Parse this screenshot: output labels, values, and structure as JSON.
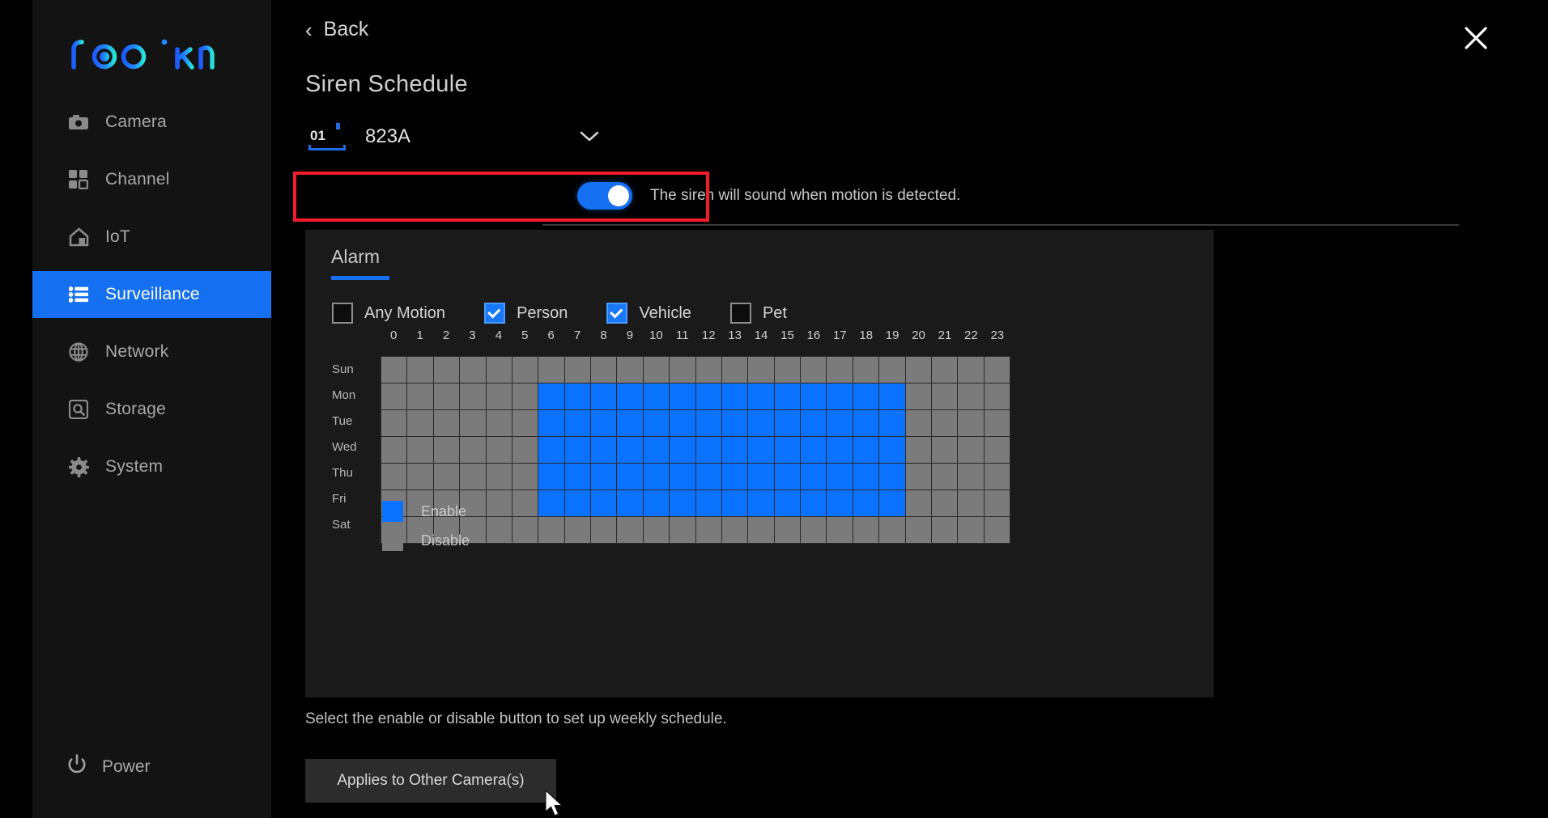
{
  "brand": {
    "name": "reolink"
  },
  "sidebar": {
    "items": [
      {
        "label": "Camera",
        "icon": "camera-icon",
        "active": false
      },
      {
        "label": "Channel",
        "icon": "channel-grid-icon",
        "active": false
      },
      {
        "label": "IoT",
        "icon": "home-iot-icon",
        "active": false
      },
      {
        "label": "Surveillance",
        "icon": "list-icon",
        "active": true
      },
      {
        "label": "Network",
        "icon": "globe-icon",
        "active": false
      },
      {
        "label": "Storage",
        "icon": "hdd-search-icon",
        "active": false
      },
      {
        "label": "System",
        "icon": "gear-icon",
        "active": false
      }
    ],
    "power": {
      "label": "Power",
      "icon": "power-icon"
    }
  },
  "header": {
    "back_label": "Back",
    "back_icon": "chevron-left-icon",
    "close_icon": "close-icon",
    "title": "Siren Schedule"
  },
  "channel_selector": {
    "number": "01",
    "name": "823A",
    "chevron_icon": "chevron-down-icon"
  },
  "siren_toggle": {
    "state": "on",
    "description": "The siren will sound when motion is detected.",
    "highlight_color": "#f41c28"
  },
  "panel": {
    "tab_label": "Alarm",
    "tab_accent": "#1470f0",
    "detection_types": [
      {
        "label": "Any Motion",
        "checked": false
      },
      {
        "label": "Person",
        "checked": true
      },
      {
        "label": "Vehicle",
        "checked": true
      },
      {
        "label": "Pet",
        "checked": false
      }
    ],
    "hours": [
      "0",
      "1",
      "2",
      "3",
      "4",
      "5",
      "6",
      "7",
      "8",
      "9",
      "10",
      "11",
      "12",
      "13",
      "14",
      "15",
      "16",
      "17",
      "18",
      "19",
      "20",
      "21",
      "22",
      "23"
    ],
    "days": [
      "Sun",
      "Mon",
      "Tue",
      "Wed",
      "Thu",
      "Fri",
      "Sat"
    ],
    "schedule": [
      [
        0,
        0,
        0,
        0,
        0,
        0,
        0,
        0,
        0,
        0,
        0,
        0,
        0,
        0,
        0,
        0,
        0,
        0,
        0,
        0,
        0,
        0,
        0,
        0
      ],
      [
        0,
        0,
        0,
        0,
        0,
        0,
        1,
        1,
        1,
        1,
        1,
        1,
        1,
        1,
        1,
        1,
        1,
        1,
        1,
        1,
        0,
        0,
        0,
        0
      ],
      [
        0,
        0,
        0,
        0,
        0,
        0,
        1,
        1,
        1,
        1,
        1,
        1,
        1,
        1,
        1,
        1,
        1,
        1,
        1,
        1,
        0,
        0,
        0,
        0
      ],
      [
        0,
        0,
        0,
        0,
        0,
        0,
        1,
        1,
        1,
        1,
        1,
        1,
        1,
        1,
        1,
        1,
        1,
        1,
        1,
        1,
        0,
        0,
        0,
        0
      ],
      [
        0,
        0,
        0,
        0,
        0,
        0,
        1,
        1,
        1,
        1,
        1,
        1,
        1,
        1,
        1,
        1,
        1,
        1,
        1,
        1,
        0,
        0,
        0,
        0
      ],
      [
        0,
        0,
        0,
        0,
        0,
        0,
        1,
        1,
        1,
        1,
        1,
        1,
        1,
        1,
        1,
        1,
        1,
        1,
        1,
        1,
        0,
        0,
        0,
        0
      ],
      [
        0,
        0,
        0,
        0,
        0,
        0,
        0,
        0,
        0,
        0,
        0,
        0,
        0,
        0,
        0,
        0,
        0,
        0,
        0,
        0,
        0,
        0,
        0,
        0
      ]
    ],
    "legend": [
      {
        "label": "Enable",
        "color": "#0a72ff"
      },
      {
        "label": "Disable",
        "color": "#7b7b7b"
      }
    ]
  },
  "footer": {
    "hint": "Select the enable or disable button to set up weekly schedule.",
    "apply_button": "Applies to Other Camera(s)"
  }
}
